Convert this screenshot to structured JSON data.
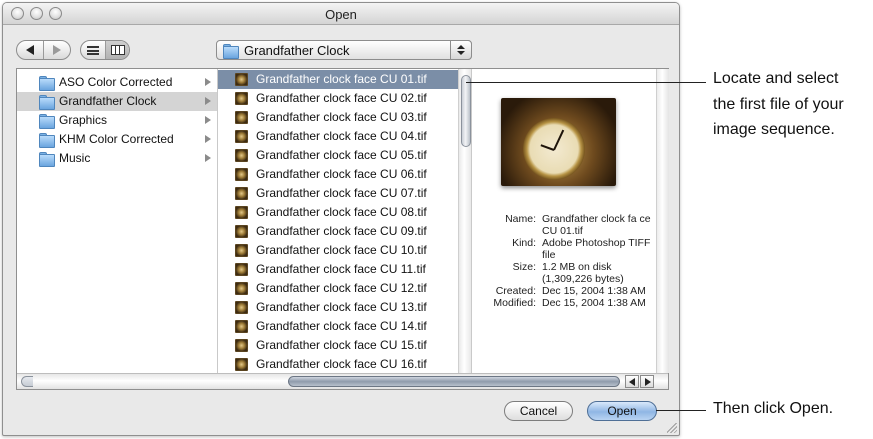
{
  "window": {
    "title": "Open"
  },
  "toolbar": {
    "location": "Grandfather Clock"
  },
  "sidebar_column": {
    "items": [
      {
        "label": "ASO Color Corrected"
      },
      {
        "label": "Grandfather Clock"
      },
      {
        "label": "Graphics"
      },
      {
        "label": "KHM Color Corrected"
      },
      {
        "label": "Music"
      }
    ],
    "selected_index": 1
  },
  "files_column": {
    "items": [
      {
        "label": "Grandfather clock face CU 01.tif"
      },
      {
        "label": "Grandfather clock face CU 02.tif"
      },
      {
        "label": "Grandfather clock face CU 03.tif"
      },
      {
        "label": "Grandfather clock face CU 04.tif"
      },
      {
        "label": "Grandfather clock face CU 05.tif"
      },
      {
        "label": "Grandfather clock face CU 06.tif"
      },
      {
        "label": "Grandfather clock face CU 07.tif"
      },
      {
        "label": "Grandfather clock face CU 08.tif"
      },
      {
        "label": "Grandfather clock face CU 09.tif"
      },
      {
        "label": "Grandfather clock face CU 10.tif"
      },
      {
        "label": "Grandfather clock face CU 11.tif"
      },
      {
        "label": "Grandfather clock face CU 12.tif"
      },
      {
        "label": "Grandfather clock face CU 13.tif"
      },
      {
        "label": "Grandfather clock face CU 14.tif"
      },
      {
        "label": "Grandfather clock face CU 15.tif"
      },
      {
        "label": "Grandfather clock face CU 16.tif"
      }
    ],
    "selected_index": 0
  },
  "preview": {
    "name_key": "Name:",
    "name_val": "Grandfather clock fa ce CU 01.tif",
    "kind_key": "Kind:",
    "kind_val": "Adobe Photoshop TIFF file",
    "size_key": "Size:",
    "size_val": "1.2 MB on disk (1,309,226 bytes)",
    "created_key": "Created:",
    "created_val": "Dec 15, 2004 1:38 AM",
    "modified_key": "Modified:",
    "modified_val": "Dec 15, 2004 1:38 AM"
  },
  "buttons": {
    "cancel": "Cancel",
    "open": "Open"
  },
  "callouts": {
    "select_line1": "Locate and select",
    "select_line2": "the first file of your",
    "select_line3": "image sequence.",
    "open_hint": "Then click Open."
  },
  "colors": {
    "selection_blue": "#7b8ea7",
    "selection_gray": "#d4d4d4",
    "folder_blue": "#6aa5de"
  }
}
